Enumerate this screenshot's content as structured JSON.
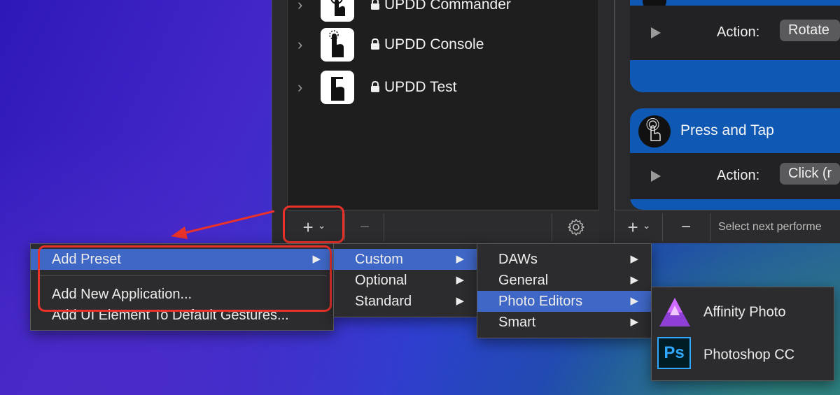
{
  "apps": [
    {
      "name": "UPDD Commander",
      "icon": "hand-touch-icon"
    },
    {
      "name": "UPDD Console",
      "icon": "hand-pointer-icon"
    },
    {
      "name": "UPDD Test",
      "icon": "hand-test-icon"
    }
  ],
  "toolbar_left": {
    "add": "+",
    "add_dropdown": "⌄",
    "remove": "−"
  },
  "toolbar_right": {
    "add": "+",
    "add_dropdown": "⌄",
    "remove": "−",
    "select_text": "Select next performe"
  },
  "gestures": {
    "card1_action_label": "Action:",
    "card1_action_value": "Rotate",
    "card2_title": "Press and Tap",
    "card2_action_label": "Action:",
    "card2_action_value": "Click (r"
  },
  "menu_main": {
    "items": [
      {
        "label": "Add Preset",
        "has_sub": true
      },
      {
        "label": "Add New Application..."
      },
      {
        "label": "Add UI Element To Default Gestures..."
      }
    ]
  },
  "menu_preset": {
    "items": [
      "Custom",
      "Optional",
      "Standard"
    ]
  },
  "menu_custom": {
    "items": [
      "DAWs",
      "General",
      "Photo Editors",
      "Smart"
    ]
  },
  "menu_photo": {
    "items": [
      {
        "label": "Affinity Photo",
        "icon": "affinity-photo-icon"
      },
      {
        "label": "Photoshop CC",
        "icon": "photoshop-icon",
        "icon_text": "Ps"
      }
    ]
  },
  "colors": {
    "accent": "#3f67c6",
    "card_blue": "#0f58b3",
    "annotation_red": "#e8322a"
  }
}
